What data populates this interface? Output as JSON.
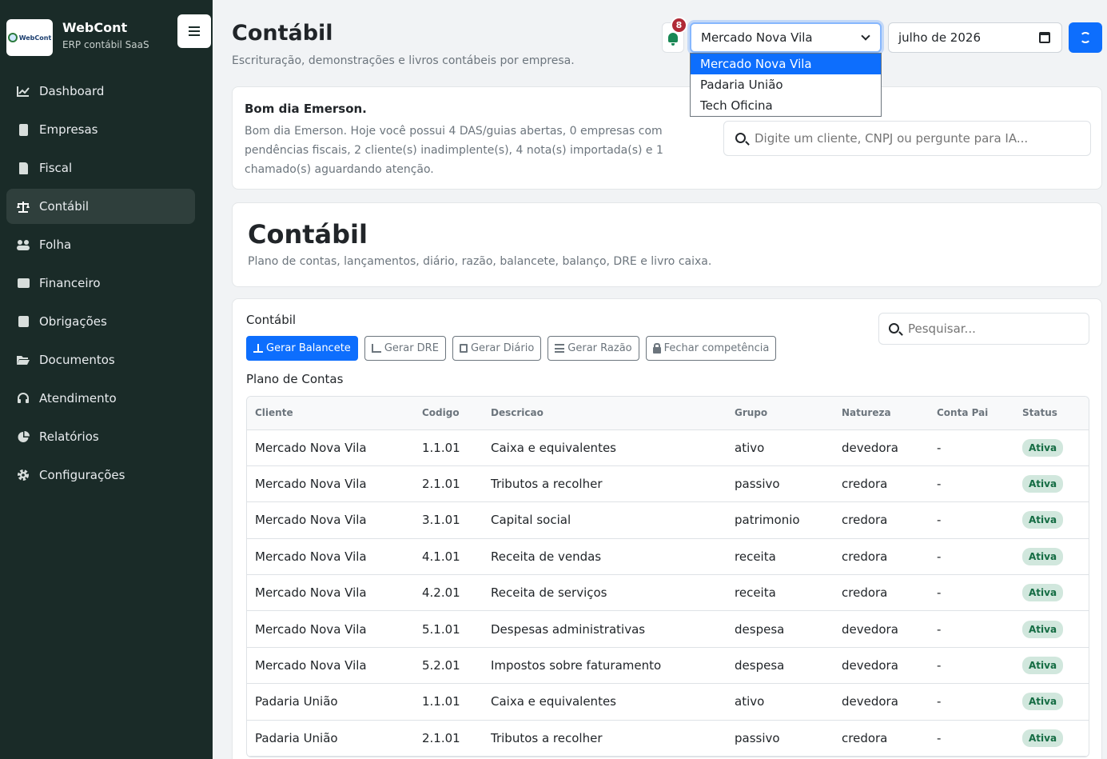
{
  "brand": {
    "name": "WebCont",
    "subtitle": "ERP contábil SaaS",
    "logo_text": "WebCont"
  },
  "sidebar": {
    "items": [
      {
        "label": "Dashboard",
        "icon": "chart-line-icon",
        "active": false
      },
      {
        "label": "Empresas",
        "icon": "building-icon",
        "active": false
      },
      {
        "label": "Fiscal",
        "icon": "file-invoice-icon",
        "active": false
      },
      {
        "label": "Contábil",
        "icon": "scale-icon",
        "active": true
      },
      {
        "label": "Folha",
        "icon": "users-icon",
        "active": false
      },
      {
        "label": "Financeiro",
        "icon": "wallet-icon",
        "active": false
      },
      {
        "label": "Obrigações",
        "icon": "calendar-check-icon",
        "active": false
      },
      {
        "label": "Documentos",
        "icon": "folder-open-icon",
        "active": false
      },
      {
        "label": "Atendimento",
        "icon": "headset-icon",
        "active": false
      },
      {
        "label": "Relatórios",
        "icon": "pie-chart-icon",
        "active": false
      },
      {
        "label": "Configurações",
        "icon": "gear-icon",
        "active": false
      }
    ]
  },
  "header": {
    "title": "Contábil",
    "subtitle": "Escrituração, demonstrações e livros contábeis por empresa.",
    "notifications": "8",
    "company_select": {
      "value": "Mercado Nova Vila",
      "options": [
        "Mercado Nova Vila",
        "Padaria União",
        "Tech Oficina"
      ]
    },
    "period": "julho de 2026"
  },
  "greeting": {
    "title": "Bom dia Emerson.",
    "text": "Bom dia Emerson. Hoje você possui 4 DAS/guias abertas, 0 empresas com pendências fiscais, 2 cliente(s) inadimplente(s), 4 nota(s) importada(s) e 1 chamado(s) aguardando atenção.",
    "search_placeholder": "Digite um cliente, CNPJ ou pergunte para IA..."
  },
  "hero": {
    "title": "Contábil",
    "subtitle": "Plano de contas, lançamentos, diário, razão, balancete, balanço, DRE e livro caixa."
  },
  "main": {
    "title": "Contábil",
    "search_placeholder": "Pesquisar...",
    "buttons": {
      "balancete": "Gerar Balancete",
      "dre": "Gerar DRE",
      "diario": "Gerar Diário",
      "razao": "Gerar Razão",
      "fechar": "Fechar competência"
    },
    "table_title": "Plano de Contas",
    "columns": [
      "Cliente",
      "Codigo",
      "Descricao",
      "Grupo",
      "Natureza",
      "Conta Pai",
      "Status"
    ],
    "rows": [
      [
        "Mercado Nova Vila",
        "1.1.01",
        "Caixa e equivalentes",
        "ativo",
        "devedora",
        "-",
        "Ativa"
      ],
      [
        "Mercado Nova Vila",
        "2.1.01",
        "Tributos a recolher",
        "passivo",
        "credora",
        "-",
        "Ativa"
      ],
      [
        "Mercado Nova Vila",
        "3.1.01",
        "Capital social",
        "patrimonio",
        "credora",
        "-",
        "Ativa"
      ],
      [
        "Mercado Nova Vila",
        "4.1.01",
        "Receita de vendas",
        "receita",
        "credora",
        "-",
        "Ativa"
      ],
      [
        "Mercado Nova Vila",
        "4.2.01",
        "Receita de serviços",
        "receita",
        "credora",
        "-",
        "Ativa"
      ],
      [
        "Mercado Nova Vila",
        "5.1.01",
        "Despesas administrativas",
        "despesa",
        "devedora",
        "-",
        "Ativa"
      ],
      [
        "Mercado Nova Vila",
        "5.2.01",
        "Impostos sobre faturamento",
        "despesa",
        "devedora",
        "-",
        "Ativa"
      ],
      [
        "Padaria União",
        "1.1.01",
        "Caixa e equivalentes",
        "ativo",
        "devedora",
        "-",
        "Ativa"
      ],
      [
        "Padaria União",
        "2.1.01",
        "Tributos a recolher",
        "passivo",
        "credora",
        "-",
        "Ativa"
      ]
    ]
  },
  "colors": {
    "sidebar_bg": "#1a2b28",
    "primary": "#0d6efd",
    "success_badge": "#d1e7dd",
    "notification_badge": "#b02a37"
  }
}
